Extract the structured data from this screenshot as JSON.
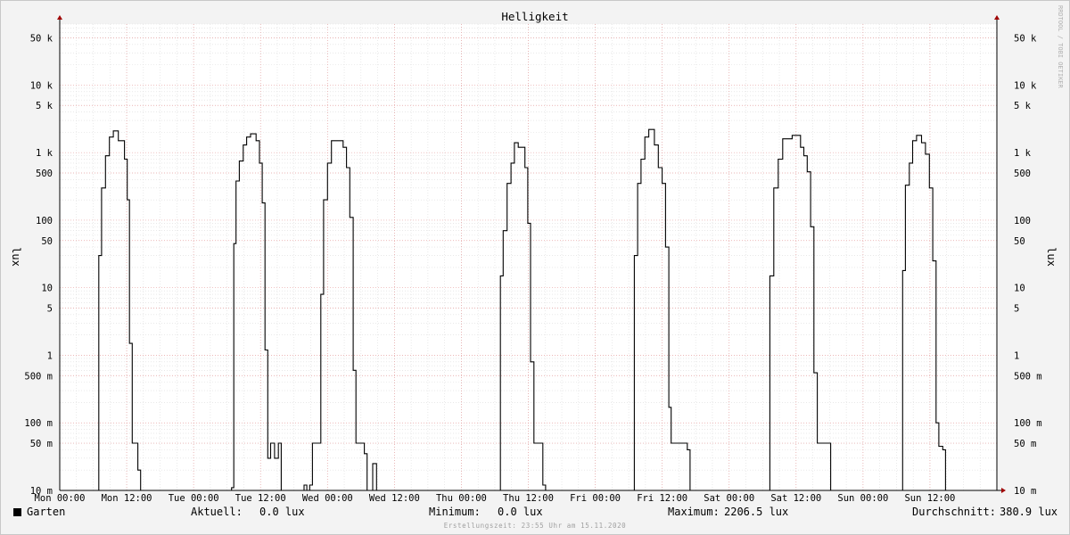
{
  "chart_data": {
    "type": "line",
    "title": "Helligkeit",
    "ylabel": "lux",
    "yscale": "log",
    "ylim": [
      0.01,
      80000
    ],
    "xlim": [
      0,
      168
    ],
    "xticks": [
      {
        "x": 0,
        "label": "Mon 00:00"
      },
      {
        "x": 12,
        "label": "Mon 12:00"
      },
      {
        "x": 24,
        "label": "Tue 00:00"
      },
      {
        "x": 36,
        "label": "Tue 12:00"
      },
      {
        "x": 48,
        "label": "Wed 00:00"
      },
      {
        "x": 60,
        "label": "Wed 12:00"
      },
      {
        "x": 72,
        "label": "Thu 00:00"
      },
      {
        "x": 84,
        "label": "Thu 12:00"
      },
      {
        "x": 96,
        "label": "Fri 00:00"
      },
      {
        "x": 108,
        "label": "Fri 12:00"
      },
      {
        "x": 120,
        "label": "Sat 00:00"
      },
      {
        "x": 132,
        "label": "Sat 12:00"
      },
      {
        "x": 144,
        "label": "Sun 00:00"
      },
      {
        "x": 156,
        "label": "Sun 12:00"
      }
    ],
    "yticks": [
      {
        "v": 50000,
        "label": "50 k"
      },
      {
        "v": 10000,
        "label": "10 k"
      },
      {
        "v": 5000,
        "label": "5 k"
      },
      {
        "v": 1000,
        "label": "1 k"
      },
      {
        "v": 500,
        "label": "500"
      },
      {
        "v": 100,
        "label": "100"
      },
      {
        "v": 50,
        "label": "50"
      },
      {
        "v": 10,
        "label": "10"
      },
      {
        "v": 5,
        "label": "5"
      },
      {
        "v": 1,
        "label": "1"
      },
      {
        "v": 0.5,
        "label": "500 m"
      },
      {
        "v": 0.1,
        "label": "100 m"
      },
      {
        "v": 0.05,
        "label": "50 m"
      },
      {
        "v": 0.01,
        "label": "10 m"
      }
    ],
    "grid": true,
    "series": [
      {
        "name": "Garten",
        "color": "#000000",
        "points": [
          [
            0,
            0.01
          ],
          [
            7.0,
            0.01
          ],
          [
            7.0,
            30
          ],
          [
            7.5,
            30
          ],
          [
            7.5,
            300
          ],
          [
            8.2,
            300
          ],
          [
            8.2,
            900
          ],
          [
            8.9,
            900
          ],
          [
            8.9,
            1700
          ],
          [
            9.6,
            1700
          ],
          [
            9.6,
            2100
          ],
          [
            10.5,
            2100
          ],
          [
            10.5,
            1500
          ],
          [
            11.6,
            1500
          ],
          [
            11.6,
            800
          ],
          [
            12.1,
            800
          ],
          [
            12.1,
            200
          ],
          [
            12.5,
            200
          ],
          [
            12.5,
            1.5
          ],
          [
            13.0,
            1.5
          ],
          [
            13.0,
            0.05
          ],
          [
            14.0,
            0.05
          ],
          [
            14.0,
            0.02
          ],
          [
            14.5,
            0.02
          ],
          [
            14.5,
            0.01
          ],
          [
            30.8,
            0.01
          ],
          [
            30.8,
            0.011
          ],
          [
            31.2,
            0.011
          ],
          [
            31.2,
            45
          ],
          [
            31.6,
            45
          ],
          [
            31.6,
            380
          ],
          [
            32.2,
            380
          ],
          [
            32.2,
            750
          ],
          [
            32.9,
            750
          ],
          [
            32.9,
            1300
          ],
          [
            33.5,
            1300
          ],
          [
            33.5,
            1700
          ],
          [
            34.2,
            1700
          ],
          [
            34.2,
            1900
          ],
          [
            35.2,
            1900
          ],
          [
            35.2,
            1500
          ],
          [
            35.8,
            1500
          ],
          [
            35.8,
            700
          ],
          [
            36.3,
            700
          ],
          [
            36.3,
            180
          ],
          [
            36.8,
            180
          ],
          [
            36.8,
            1.2
          ],
          [
            37.3,
            1.2
          ],
          [
            37.3,
            0.03
          ],
          [
            37.8,
            0.03
          ],
          [
            37.8,
            0.05
          ],
          [
            38.5,
            0.05
          ],
          [
            38.5,
            0.03
          ],
          [
            39.2,
            0.03
          ],
          [
            39.2,
            0.05
          ],
          [
            39.7,
            0.05
          ],
          [
            39.7,
            0.01
          ],
          [
            43.8,
            0.01
          ],
          [
            43.8,
            0.012
          ],
          [
            44.3,
            0.012
          ],
          [
            44.3,
            0.01
          ],
          [
            44.8,
            0.01
          ],
          [
            44.8,
            0.012
          ],
          [
            45.3,
            0.012
          ],
          [
            45.3,
            0.05
          ],
          [
            46.8,
            0.05
          ],
          [
            46.8,
            8
          ],
          [
            47.3,
            8
          ],
          [
            47.3,
            200
          ],
          [
            48.0,
            200
          ],
          [
            48.0,
            700
          ],
          [
            48.7,
            700
          ],
          [
            48.7,
            1500
          ],
          [
            50.8,
            1500
          ],
          [
            50.8,
            1200
          ],
          [
            51.4,
            1200
          ],
          [
            51.4,
            600
          ],
          [
            52.0,
            600
          ],
          [
            52.0,
            110
          ],
          [
            52.6,
            110
          ],
          [
            52.6,
            0.6
          ],
          [
            53.1,
            0.6
          ],
          [
            53.1,
            0.05
          ],
          [
            54.6,
            0.05
          ],
          [
            54.6,
            0.035
          ],
          [
            55.1,
            0.035
          ],
          [
            55.1,
            0.01
          ],
          [
            56.1,
            0.01
          ],
          [
            56.1,
            0.025
          ],
          [
            56.8,
            0.025
          ],
          [
            56.8,
            0.01
          ],
          [
            79.0,
            0.01
          ],
          [
            79.0,
            15
          ],
          [
            79.5,
            15
          ],
          [
            79.5,
            70
          ],
          [
            80.2,
            70
          ],
          [
            80.2,
            350
          ],
          [
            80.9,
            350
          ],
          [
            80.9,
            700
          ],
          [
            81.5,
            700
          ],
          [
            81.5,
            1400
          ],
          [
            82.2,
            1400
          ],
          [
            82.2,
            1200
          ],
          [
            83.4,
            1200
          ],
          [
            83.4,
            600
          ],
          [
            83.9,
            600
          ],
          [
            83.9,
            90
          ],
          [
            84.4,
            90
          ],
          [
            84.4,
            0.8
          ],
          [
            85.0,
            0.8
          ],
          [
            85.0,
            0.05
          ],
          [
            86.6,
            0.05
          ],
          [
            86.6,
            0.012
          ],
          [
            87.1,
            0.012
          ],
          [
            87.1,
            0.01
          ],
          [
            103.0,
            0.01
          ],
          [
            103.0,
            30
          ],
          [
            103.6,
            30
          ],
          [
            103.6,
            350
          ],
          [
            104.2,
            350
          ],
          [
            104.2,
            800
          ],
          [
            104.9,
            800
          ],
          [
            104.9,
            1700
          ],
          [
            105.6,
            1700
          ],
          [
            105.6,
            2200
          ],
          [
            106.6,
            2200
          ],
          [
            106.6,
            1300
          ],
          [
            107.3,
            1300
          ],
          [
            107.3,
            600
          ],
          [
            108.0,
            600
          ],
          [
            108.0,
            350
          ],
          [
            108.6,
            350
          ],
          [
            108.6,
            40
          ],
          [
            109.2,
            40
          ],
          [
            109.2,
            0.17
          ],
          [
            109.6,
            0.17
          ],
          [
            109.6,
            0.05
          ],
          [
            112.5,
            0.05
          ],
          [
            112.5,
            0.04
          ],
          [
            113.0,
            0.04
          ],
          [
            113.0,
            0.01
          ],
          [
            127.3,
            0.01
          ],
          [
            127.3,
            15
          ],
          [
            128.0,
            15
          ],
          [
            128.0,
            300
          ],
          [
            128.8,
            300
          ],
          [
            128.8,
            800
          ],
          [
            129.6,
            800
          ],
          [
            129.6,
            1600
          ],
          [
            131.3,
            1600
          ],
          [
            131.3,
            1800
          ],
          [
            132.8,
            1800
          ],
          [
            132.8,
            1200
          ],
          [
            133.4,
            1200
          ],
          [
            133.4,
            900
          ],
          [
            134.0,
            900
          ],
          [
            134.0,
            520
          ],
          [
            134.6,
            520
          ],
          [
            134.6,
            80
          ],
          [
            135.2,
            80
          ],
          [
            135.2,
            0.55
          ],
          [
            135.8,
            0.55
          ],
          [
            135.8,
            0.05
          ],
          [
            138.2,
            0.05
          ],
          [
            138.2,
            0.01
          ],
          [
            151.1,
            0.01
          ],
          [
            151.1,
            18
          ],
          [
            151.6,
            18
          ],
          [
            151.6,
            330
          ],
          [
            152.3,
            330
          ],
          [
            152.3,
            700
          ],
          [
            152.9,
            700
          ],
          [
            152.9,
            1500
          ],
          [
            153.6,
            1500
          ],
          [
            153.6,
            1800
          ],
          [
            154.5,
            1800
          ],
          [
            154.5,
            1400
          ],
          [
            155.2,
            1400
          ],
          [
            155.2,
            950
          ],
          [
            155.9,
            950
          ],
          [
            155.9,
            300
          ],
          [
            156.5,
            300
          ],
          [
            156.5,
            25
          ],
          [
            157.1,
            25
          ],
          [
            157.1,
            0.1
          ],
          [
            157.6,
            0.1
          ],
          [
            157.6,
            0.045
          ],
          [
            158.3,
            0.045
          ],
          [
            158.3,
            0.04
          ],
          [
            158.8,
            0.04
          ],
          [
            158.8,
            0.01
          ],
          [
            168,
            0.01
          ]
        ]
      }
    ]
  },
  "watermark": "RRDTOOL / TOBI OETIKER",
  "legend": {
    "name": "Garten",
    "current_label": "Aktuell:",
    "current_value": "0.0 lux",
    "min_label": "Minimum:",
    "min_value": "0.0 lux",
    "max_label": "Maximum:",
    "max_value": "2206.5 lux",
    "avg_label": "Durchschnitt:",
    "avg_value": "380.9 lux"
  },
  "footer": "Erstellungszeit: 23:55 Uhr am 15.11.2020"
}
